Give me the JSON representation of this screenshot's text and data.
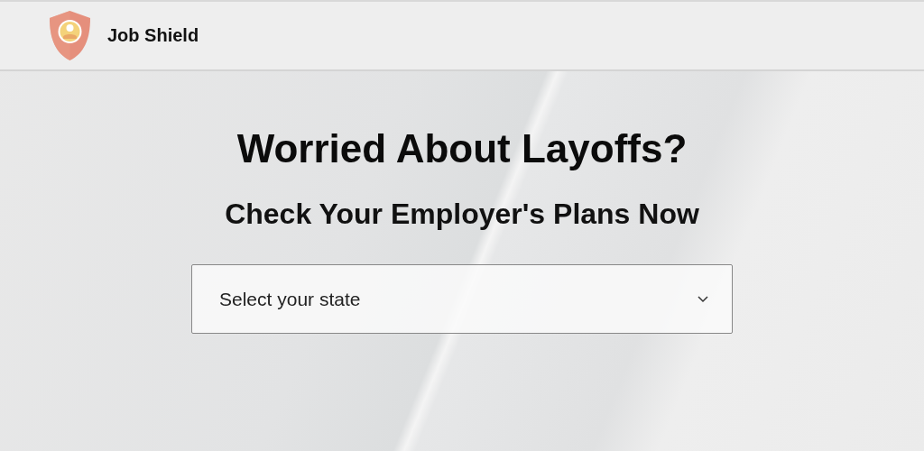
{
  "header": {
    "brand": "Job Shield"
  },
  "hero": {
    "headline": "Worried About Layoffs?",
    "subheadline": "Check Your Employer's Plans Now",
    "state_select": {
      "placeholder": "Select your state"
    }
  }
}
